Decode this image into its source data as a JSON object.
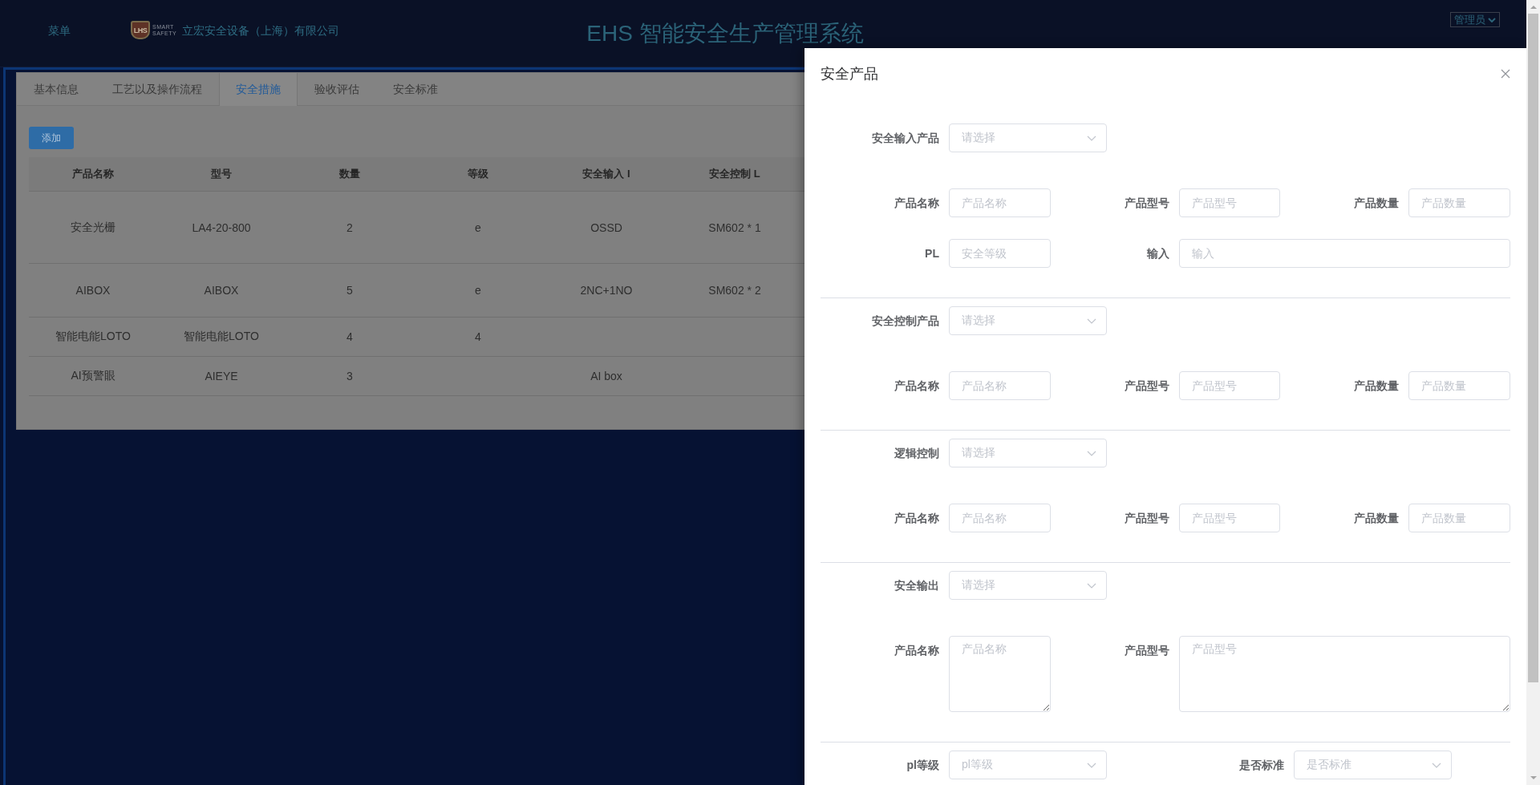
{
  "header": {
    "menu": "菜单",
    "logo": {
      "mark": "LHS",
      "wordmark": [
        "SMART",
        "SAFETY"
      ]
    },
    "company": "立宏安全设备（上海）有限公司",
    "title": "EHS 智能安全生产管理系统",
    "user_menu": "管理员"
  },
  "tabs": [
    {
      "label": "基本信息",
      "selected": false
    },
    {
      "label": "工艺以及操作流程",
      "selected": false
    },
    {
      "label": "安全措施",
      "selected": true
    },
    {
      "label": "验收评估",
      "selected": false
    },
    {
      "label": "安全标准",
      "selected": false
    }
  ],
  "add_button": "添加",
  "table": {
    "columns": [
      "产品名称",
      "型号",
      "数量",
      "等级",
      "安全输入 I",
      "安全控制 L"
    ],
    "rows": [
      {
        "name": "安全光栅",
        "model": "LA4-20-800",
        "quantity": "2",
        "grade": "e",
        "safety_input": "OSSD",
        "safety_control": "SM602 * 1"
      },
      {
        "name": "AIBOX",
        "model": "AIBOX",
        "quantity": "5",
        "grade": "e",
        "safety_input": "2NC+1NO",
        "safety_control": "SM602 * 2"
      },
      {
        "name": "智能电能LOTO",
        "model": "智能电能LOTO",
        "quantity": "4",
        "grade": "4"
      },
      {
        "name": "AI预警眼",
        "model": "AIEYE",
        "quantity": "3",
        "safety_input": "AI box"
      }
    ]
  },
  "drawer": {
    "title": "安全产品",
    "sections": [
      {
        "rows": [
          {
            "kind": "single",
            "fields": [
              {
                "kind": "select",
                "label": "安全输入产品",
                "placeholder": "请选择"
              }
            ]
          },
          {
            "kind": "thirds",
            "fields": [
              {
                "kind": "input",
                "label": "产品名称",
                "placeholder": "产品名称"
              },
              {
                "kind": "input",
                "label": "产品型号",
                "placeholder": "产品型号"
              },
              {
                "kind": "input",
                "label": "产品数量",
                "placeholder": "产品数量"
              }
            ]
          },
          {
            "kind": "third-and-rest",
            "fields": [
              {
                "kind": "input",
                "label": "PL",
                "placeholder": "安全等级"
              },
              {
                "kind": "input",
                "label": "输入",
                "placeholder": "输入"
              }
            ]
          }
        ]
      },
      {
        "rows": [
          {
            "kind": "single",
            "fields": [
              {
                "kind": "select",
                "label": "安全控制产品",
                "placeholder": "请选择"
              }
            ]
          },
          {
            "kind": "thirds",
            "fields": [
              {
                "kind": "input",
                "label": "产品名称",
                "placeholder": "产品名称"
              },
              {
                "kind": "input",
                "label": "产品型号",
                "placeholder": "产品型号"
              },
              {
                "kind": "input",
                "label": "产品数量",
                "placeholder": "产品数量"
              }
            ]
          }
        ]
      },
      {
        "rows": [
          {
            "kind": "single",
            "fields": [
              {
                "kind": "select",
                "label": "逻辑控制",
                "placeholder": "请选择"
              }
            ]
          },
          {
            "kind": "thirds",
            "fields": [
              {
                "kind": "input",
                "label": "产品名称",
                "placeholder": "产品名称"
              },
              {
                "kind": "input",
                "label": "产品型号",
                "placeholder": "产品型号"
              },
              {
                "kind": "input",
                "label": "产品数量",
                "placeholder": "产品数量"
              }
            ]
          }
        ]
      },
      {
        "rows": [
          {
            "kind": "single",
            "fields": [
              {
                "kind": "select",
                "label": "安全输出",
                "placeholder": "请选择"
              }
            ]
          },
          {
            "kind": "third-and-rest",
            "fields": [
              {
                "kind": "textarea",
                "label": "产品名称",
                "placeholder": "产品名称"
              },
              {
                "kind": "textarea",
                "label": "产品型号",
                "placeholder": "产品型号"
              }
            ]
          }
        ]
      },
      {
        "rows": [
          {
            "kind": "halves",
            "fields": [
              {
                "kind": "select",
                "label": "pl等级",
                "placeholder": "pl等级"
              },
              {
                "kind": "select",
                "label": "是否标准",
                "placeholder": "是否标准"
              }
            ]
          }
        ]
      }
    ]
  }
}
